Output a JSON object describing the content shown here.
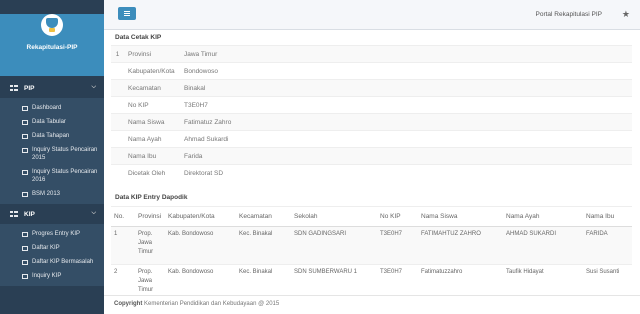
{
  "brand": {
    "title": "Rekapitulasi-PIP"
  },
  "sidebar": {
    "sections": [
      {
        "label": "PIP",
        "items": [
          {
            "label": "Dashboard"
          },
          {
            "label": "Data Tabular"
          },
          {
            "label": "Data Tahapan"
          },
          {
            "label": "Inquiry Status Pencairan 2015"
          },
          {
            "label": "Inquiry Status Pencairan 2016"
          },
          {
            "label": "BSM 2013"
          }
        ]
      },
      {
        "label": "KIP",
        "items": [
          {
            "label": "Progres Entry KIP"
          },
          {
            "label": "Daftar KIP"
          },
          {
            "label": "Daftar KIP Bermasalah"
          },
          {
            "label": "Inquiry KIP"
          }
        ]
      }
    ]
  },
  "topbar": {
    "site_title": "Portal Rekapitulasi PIP"
  },
  "kip_print": {
    "title": "Data Cetak KIP",
    "row_number": "1",
    "rows": [
      {
        "label": "Provinsi",
        "value": "Jawa Timur"
      },
      {
        "label": "Kabupaten/Kota",
        "value": "Bondowoso"
      },
      {
        "label": "Kecamatan",
        "value": "Binakal"
      },
      {
        "label": "No KIP",
        "value": "T3E0H7"
      },
      {
        "label": "Nama Siswa",
        "value": "Fatimatuz Zahro"
      },
      {
        "label": "Nama Ayah",
        "value": "Ahmad Sukardi"
      },
      {
        "label": "Nama Ibu",
        "value": "Farida"
      },
      {
        "label": "Dicetak Oleh",
        "value": "Direktorat SD"
      }
    ]
  },
  "kip_entry": {
    "title": "Data KIP Entry Dapodik",
    "columns": [
      "No.",
      "Provinsi",
      "Kabupaten/Kota",
      "Kecamatan",
      "Sekolah",
      "No KIP",
      "Nama Siswa",
      "Nama Ayah",
      "Nama Ibu"
    ],
    "rows": [
      [
        "1",
        "Prop. Jawa Timur",
        "Kab. Bondowoso",
        "Kec. Binakal",
        "SDN GADINGSARI",
        "T3E0H7",
        "FATIMAHTUZ ZAHRO",
        "AHMAD SUKARDI",
        "FARIDA"
      ],
      [
        "2",
        "Prop. Jawa Timur",
        "Kab. Bondowoso",
        "Kec. Binakal",
        "SDN SUMBERWARU 1",
        "T3E0H7",
        "Fatimatuzzahro",
        "Taufik Hidayat",
        "Susi Susanti"
      ]
    ]
  },
  "footer": {
    "copyright_label": "Copyright",
    "text": "Kementerian Pendidikan dan Kebudayaan @ 2015"
  }
}
